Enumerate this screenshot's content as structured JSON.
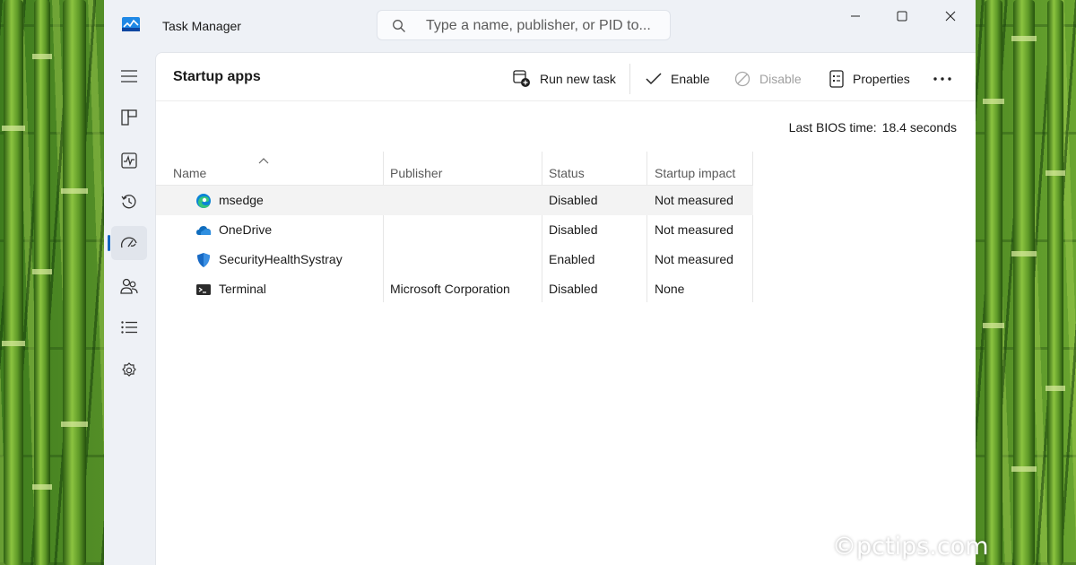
{
  "app": {
    "title": "Task Manager",
    "search_placeholder": "Type a name, publisher, or PID to..."
  },
  "nav": {
    "items": [
      {
        "icon": "hamburger-menu-icon"
      },
      {
        "icon": "processes-icon"
      },
      {
        "icon": "performance-icon"
      },
      {
        "icon": "app-history-icon"
      },
      {
        "icon": "startup-apps-icon",
        "active": true
      },
      {
        "icon": "users-icon"
      },
      {
        "icon": "details-icon"
      },
      {
        "icon": "services-icon"
      }
    ]
  },
  "page": {
    "title": "Startup apps",
    "bios_label": "Last BIOS time:",
    "bios_value": "18.4 seconds"
  },
  "toolbar": {
    "run_new_task": "Run new task",
    "enable": "Enable",
    "disable": "Disable",
    "properties": "Properties"
  },
  "table": {
    "columns": [
      "Name",
      "Publisher",
      "Status",
      "Startup impact"
    ],
    "rows": [
      {
        "name": "msedge",
        "publisher": "",
        "status": "Disabled",
        "impact": "Not measured",
        "icon": "edge-icon"
      },
      {
        "name": "OneDrive",
        "publisher": "",
        "status": "Disabled",
        "impact": "Not measured",
        "icon": "onedrive-icon"
      },
      {
        "name": "SecurityHealthSystray",
        "publisher": "",
        "status": "Enabled",
        "impact": "Not measured",
        "icon": "windows-security-icon"
      },
      {
        "name": "Terminal",
        "publisher": "Microsoft Corporation",
        "status": "Disabled",
        "impact": "None",
        "icon": "terminal-icon"
      }
    ]
  },
  "watermark": "©pctips.com",
  "colors": {
    "accent": "#1565c0",
    "window_bg": "#eef1f6",
    "content_bg": "#ffffff"
  }
}
